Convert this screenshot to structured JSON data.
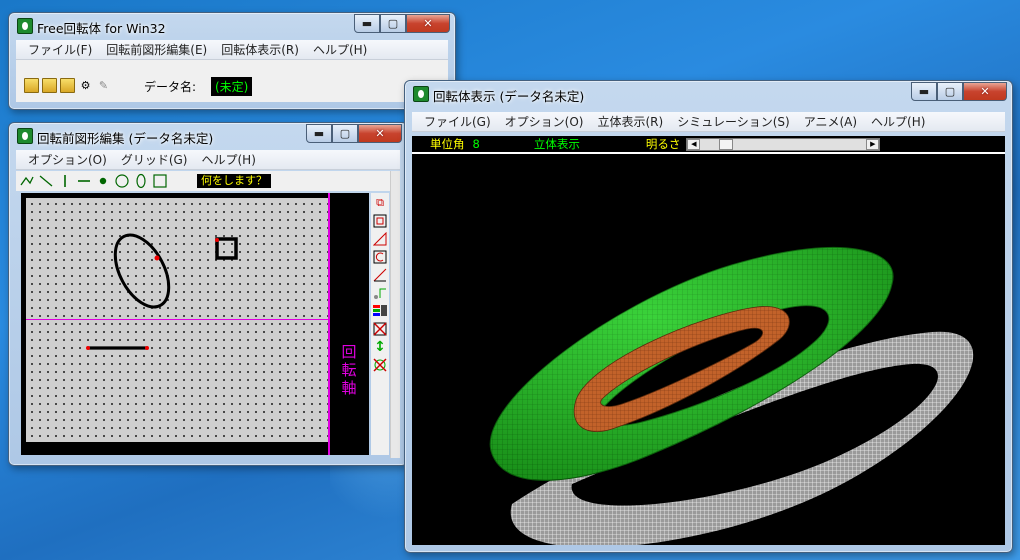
{
  "windows": {
    "main": {
      "title": "Free回転体 for Win32",
      "menu": [
        "ファイル(F)",
        "回転前図形編集(E)",
        "回転体表示(R)",
        "ヘルプ(H)"
      ],
      "data_name_label": "データ名:",
      "data_name_value": "(未定)"
    },
    "editor": {
      "title": "回転前図形編集 (データ名未定)",
      "menu": [
        "オプション(O)",
        "グリッド(G)",
        "ヘルプ(H)"
      ],
      "prompt": "何をします？",
      "axis_label": "回転軸"
    },
    "viewer": {
      "title": "回転体表示 (データ名未定)",
      "menu": [
        "ファイル(G)",
        "オプション(O)",
        "立体表示(R)",
        "シミュレーション(S)",
        "アニメ(A)",
        "ヘルプ(H)"
      ],
      "status": {
        "unit_angle_label": "単位角",
        "unit_angle_value": "8",
        "mode": "立体表示",
        "brightness_label": "明るさ"
      }
    }
  },
  "colors": {
    "status_yellow": "#ffff00",
    "status_green": "#00ff00",
    "axis_magenta": "#e000e0",
    "torus_green": "#22c822",
    "ring_orange": "#c8642a",
    "shadow_white": "#e0e0e0"
  },
  "icons": {
    "window_buttons": [
      "minimize-icon",
      "maximize-icon",
      "close-icon"
    ]
  }
}
